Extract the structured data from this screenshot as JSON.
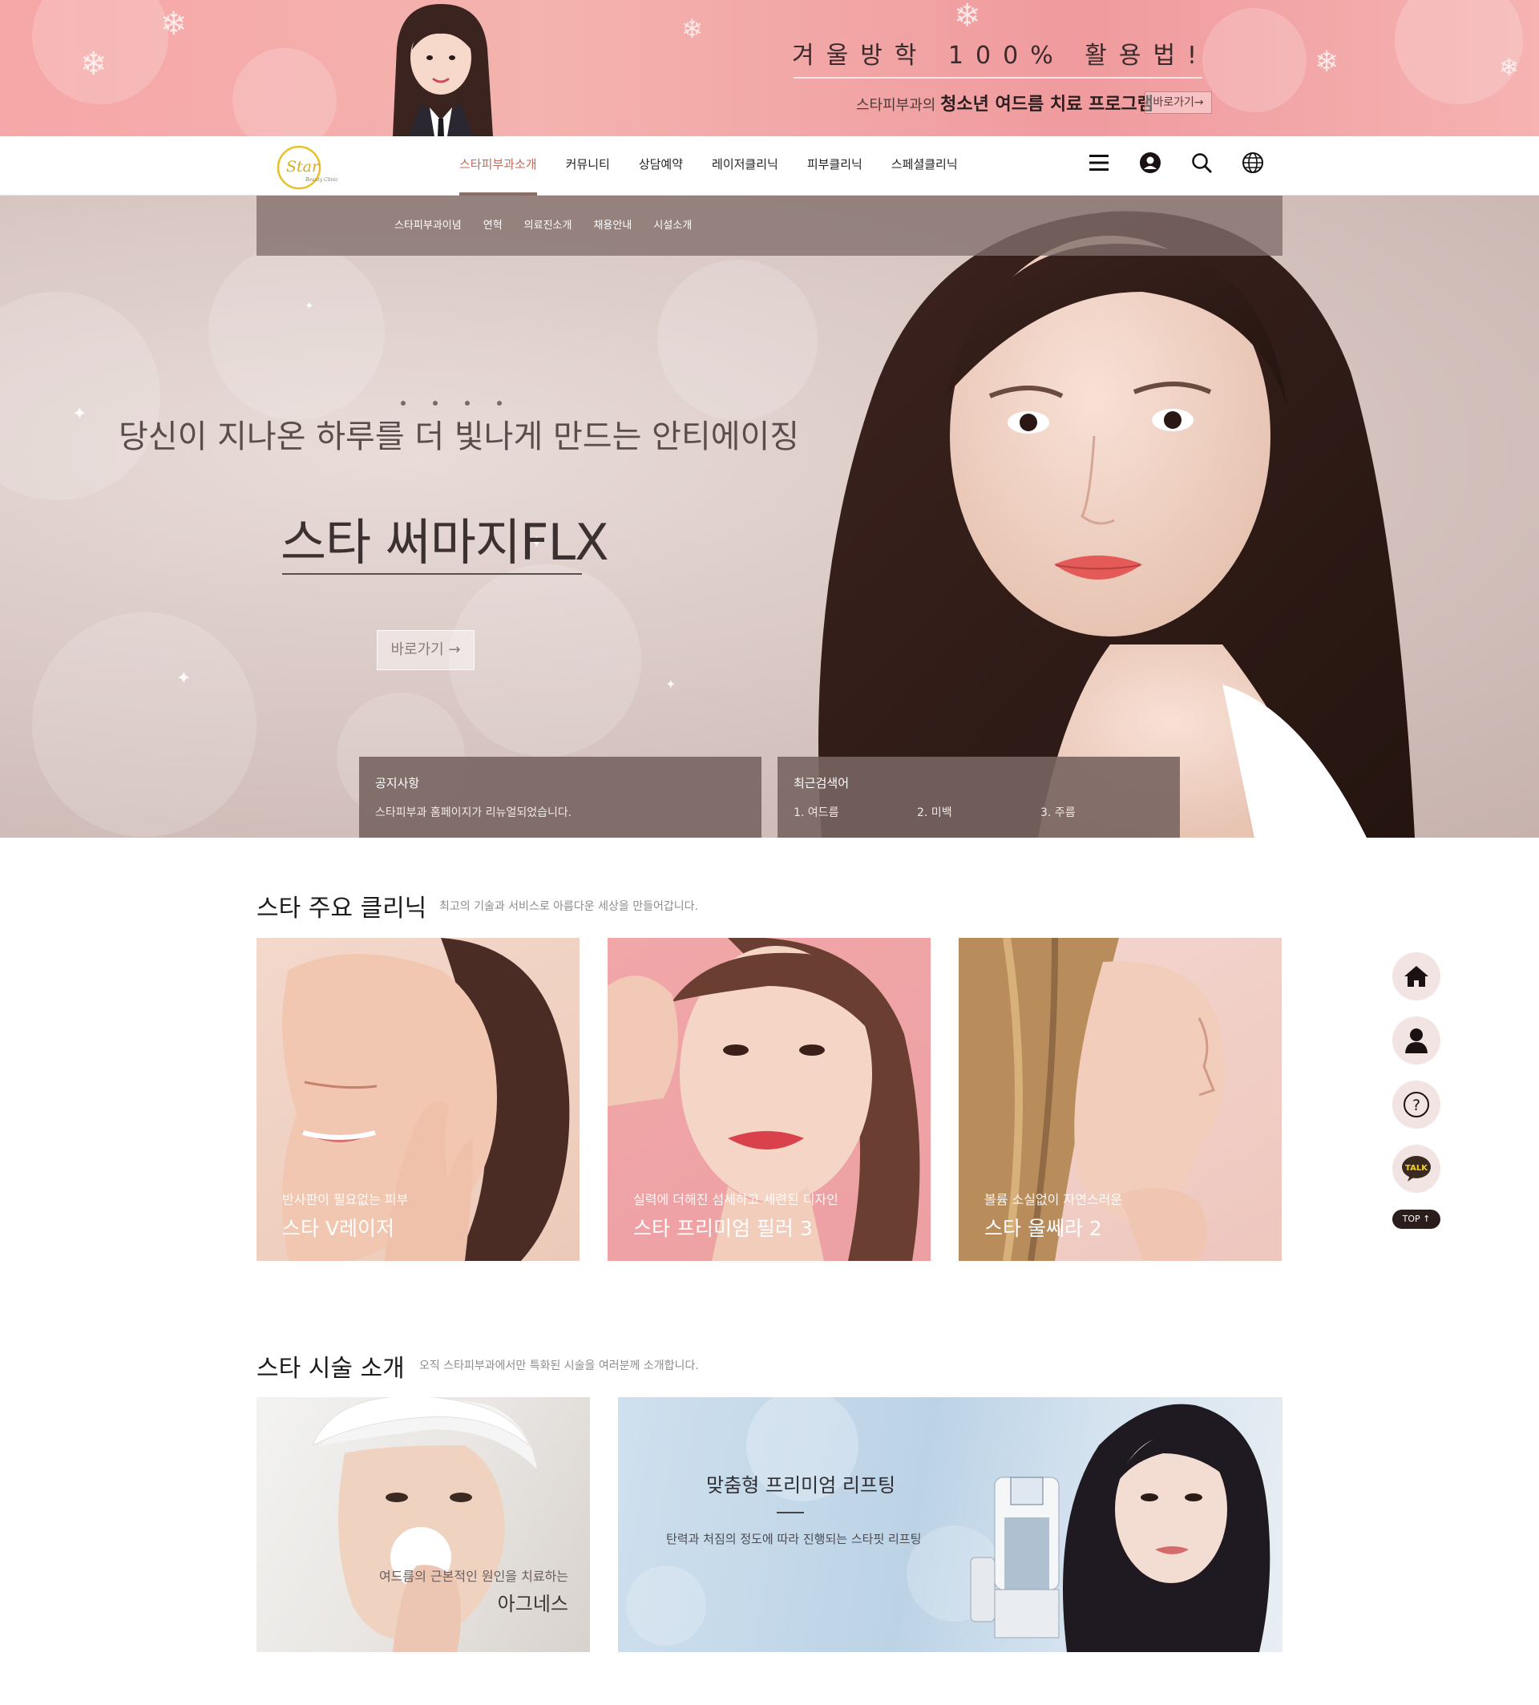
{
  "promo": {
    "title": "겨울방학 100% 활용법!",
    "sub_prefix": "스타피부과의 ",
    "sub_strong": "청소년 여드름 치료 프로그램",
    "button": "바로가기→"
  },
  "logo": {
    "text": "Star",
    "subtext": "Beauty Clinic"
  },
  "nav": {
    "items": [
      "스타피부과소개",
      "커뮤니티",
      "상담예약",
      "레이저클리닉",
      "피부클리닉",
      "스페셜클리닉"
    ],
    "active_index": 0,
    "icons": [
      "menu-icon",
      "user-icon",
      "search-icon",
      "globe-icon"
    ]
  },
  "submenu": [
    "스타피부과이념",
    "연혁",
    "의료진소개",
    "채용안내",
    "시설소개"
  ],
  "hero": {
    "copy": "당신이 지나온 하루를 더 빛나게 만드는 안티에이징",
    "title": "스타 써마지FLX",
    "button": "바로가기 →",
    "notice": {
      "title": "공지사항",
      "text": "스타피부과 홈페이지가 리뉴얼되었습니다."
    },
    "recent": {
      "title": "최근검색어",
      "keywords": [
        "1. 여드름",
        "2. 미백",
        "3. 주름"
      ]
    }
  },
  "clinic": {
    "title": "스타 주요 클리닉",
    "desc": "최고의 기술과 서비스로 아름다운 세상을 만들어갑니다.",
    "cards": [
      {
        "sub": "반사판이 필요없는 피부",
        "name": "스타 V레이저"
      },
      {
        "sub": "실력에 더해진 섬세하고 세련된 디자인",
        "name": "스타 프리미엄 필러 3"
      },
      {
        "sub": "볼륨 소실없이 자연스러운",
        "name": "스타 울쎄라 2"
      }
    ]
  },
  "quick_menu": {
    "icons": [
      "home-icon",
      "person-icon",
      "question-icon",
      "kakao-talk-icon"
    ],
    "talk_label": "TALK",
    "top_label": "TOP ↑"
  },
  "intro": {
    "title": "스타 시술 소개",
    "desc": "오직 스타피부과에서만 특화된 시술을 여러분께 소개합니다.",
    "item1": {
      "sub": "여드름의 근본적인 원인을 치료하는",
      "name": "아그네스"
    },
    "item2": {
      "title": "맞춤형 프리미엄 리프팅",
      "desc": "탄력과 처짐의 정도에 따라 진행되는 스타핏 리프팅"
    }
  },
  "colors": {
    "accent": "#c36a58",
    "panel": "#7a6460",
    "promo": "#f4a9a9"
  }
}
